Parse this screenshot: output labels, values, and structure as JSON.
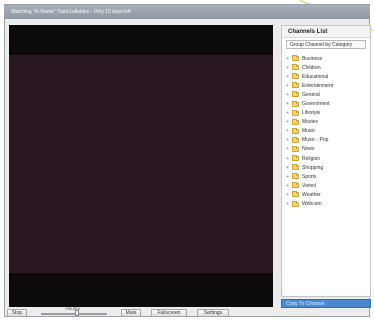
{
  "window": {
    "title": "Watching \"In Name\" Trust Lullabies - Only 10 days left"
  },
  "channels_panel": {
    "title": "Channels List",
    "group_by": "Group Channel by Category",
    "categories": [
      "Business",
      "Children",
      "Educational",
      "Entertainment",
      "General",
      "Government",
      "Lifestyle",
      "Movies",
      "Music",
      "Music - Pop",
      "News",
      "Religion",
      "Shopping",
      "Sports",
      "Varied",
      "Weather",
      "Webcam"
    ],
    "search_label": "Copy To Channel"
  },
  "controls": {
    "stop_label": "Stop",
    "volume_label": "Volume",
    "volume_level": 0.55,
    "mute_label": "Mute",
    "fullscreen_label": "Fullscreen",
    "settings_label": "Settings"
  },
  "colors": {
    "video_frame": "#0c0a0b",
    "video_content": "#2a1721",
    "selection_blue": "#4a8ad0",
    "folder_yellow": "#f2d479"
  }
}
